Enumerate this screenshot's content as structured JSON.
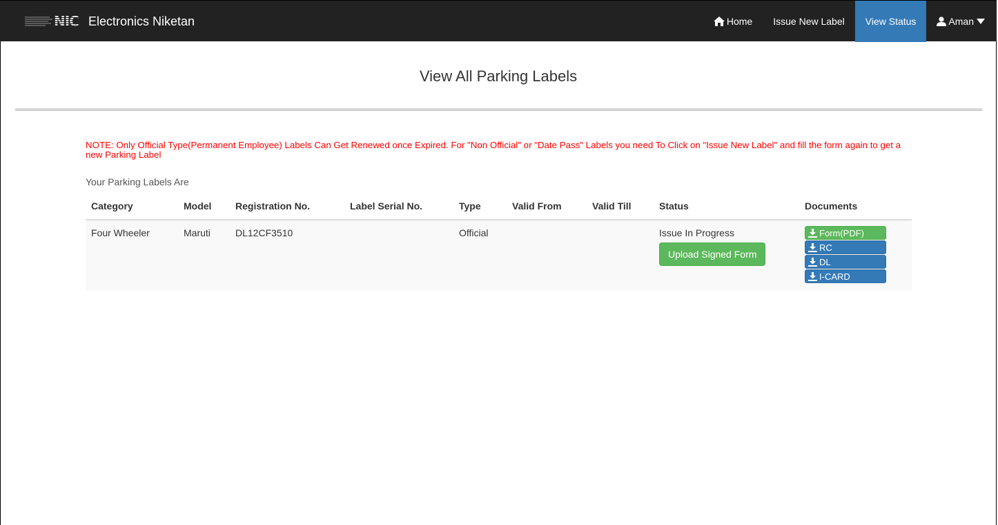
{
  "navbar": {
    "brand": "Electronics Niketan",
    "logo_text": "NIC",
    "items": [
      {
        "label": "Home",
        "icon": "home-icon"
      },
      {
        "label": "Issue New Label"
      },
      {
        "label": "View Status",
        "active": true
      },
      {
        "label": "Aman",
        "icon": "user-icon",
        "dropdown": true
      }
    ]
  },
  "header": {
    "title": "View All Parking Labels"
  },
  "note": "NOTE: Only Official Type(Permanent Employee) Labels Can Get Renewed once Expired. For \"Non Official\" or \"Date Pass\" Labels you need To Click on \"Issue New Label\" and fill the form again to get a new Parking Label",
  "subtitle": "Your Parking Labels Are",
  "table": {
    "columns": [
      "Category",
      "Model",
      "Registration No.",
      "Label Serial No.",
      "Type",
      "Valid From",
      "Valid Till",
      "Status",
      "Documents"
    ],
    "rows": [
      {
        "category": "Four Wheeler",
        "model": "Maruti",
        "registration": "DL12CF3510",
        "serial": "",
        "type": "Official",
        "valid_from": "",
        "valid_till": "",
        "status": "Issue In Progress",
        "upload_label": "Upload Signed Form",
        "documents": [
          "Form(PDF)",
          "RC",
          "DL",
          "I-CARD"
        ]
      }
    ]
  },
  "colors": {
    "navbar_bg": "#222222",
    "active_nav": "#337ab7",
    "success": "#5cb85c",
    "primary": "#337ab7",
    "note": "#ff0000"
  }
}
